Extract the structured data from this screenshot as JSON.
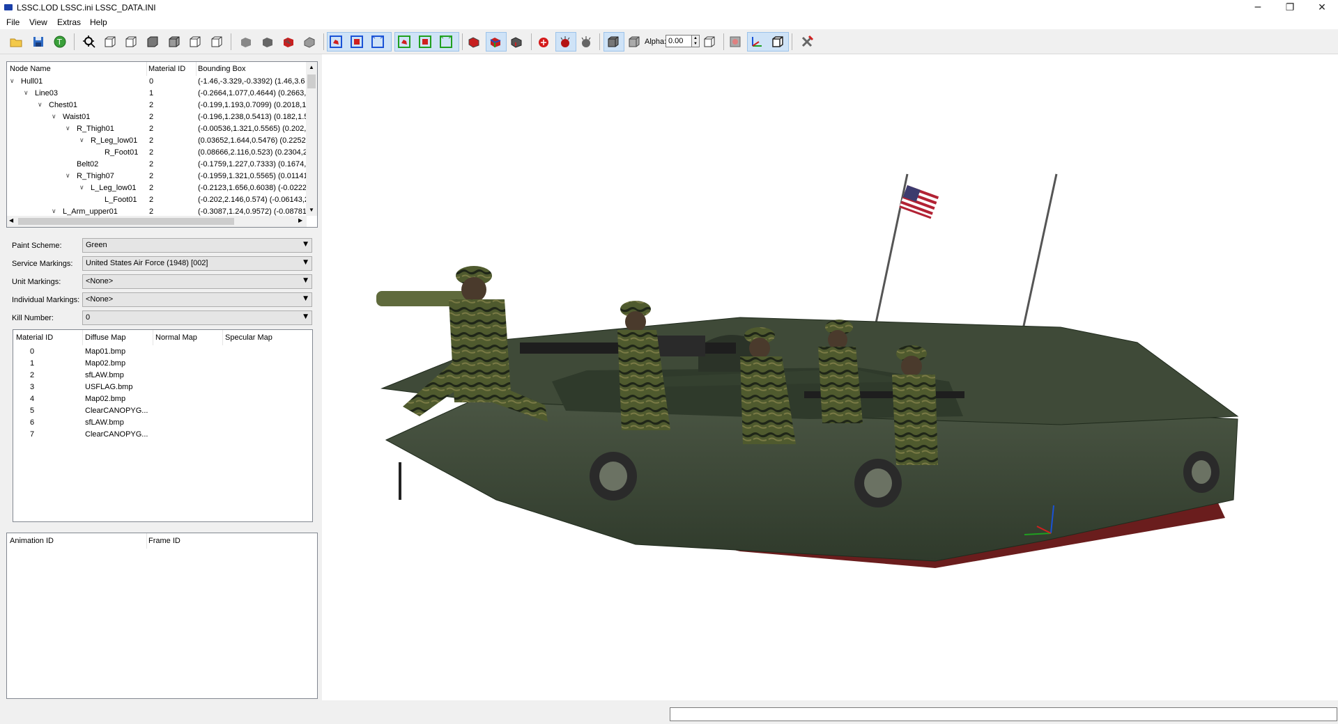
{
  "window": {
    "title": "LSSC.LOD  LSSC.ini  LSSC_DATA.INI",
    "min_glyph": "─",
    "max_glyph": "❐",
    "close_glyph": "✕"
  },
  "menu": [
    "File",
    "View",
    "Extras",
    "Help"
  ],
  "toolbar": {
    "alpha_label": "Alpha:",
    "alpha_value": "0.00"
  },
  "node_tree": {
    "headers": [
      "Node Name",
      "Material ID",
      "Bounding Box"
    ],
    "rows": [
      {
        "name": "Hull01",
        "material": "0",
        "bbox": "(-1.46,-3.329,-0.3392) (1.46,3.6"
      },
      {
        "name": "Line03",
        "material": "1",
        "bbox": "(-0.2664,1.077,0.4644) (0.2663,"
      },
      {
        "name": "Chest01",
        "material": "2",
        "bbox": "(-0.199,1.193,0.7099) (0.2018,1."
      },
      {
        "name": "Waist01",
        "material": "2",
        "bbox": "(-0.196,1.238,0.5413) (0.182,1.5"
      },
      {
        "name": "R_Thigh01",
        "material": "2",
        "bbox": "(-0.00536,1.321,0.5565) (0.202,"
      },
      {
        "name": "R_Leg_low01",
        "material": "2",
        "bbox": "(0.03652,1.644,0.5476) (0.2252,"
      },
      {
        "name": "R_Foot01",
        "material": "2",
        "bbox": "(0.08666,2.116,0.523) (0.2304,2"
      },
      {
        "name": "Belt02",
        "material": "2",
        "bbox": "(-0.1759,1.227,0.7333) (0.1674,"
      },
      {
        "name": "R_Thigh07",
        "material": "2",
        "bbox": "(-0.1959,1.321,0.5565) (0.01141"
      },
      {
        "name": "L_Leg_low01",
        "material": "2",
        "bbox": "(-0.2123,1.656,0.6038) (-0.0222"
      },
      {
        "name": "L_Foot01",
        "material": "2",
        "bbox": "(-0.202,2.146,0.574) (-0.06143,2"
      },
      {
        "name": "L_Arm_upper01",
        "material": "2",
        "bbox": "(-0.3087,1.24,0.9572) (-0.08781"
      }
    ]
  },
  "form": {
    "paint_scheme_label": "Paint Scheme:",
    "paint_scheme_value": "Green",
    "service_markings_label": "Service Markings:",
    "service_markings_value": "United States Air Force (1948) [002]",
    "unit_markings_label": "Unit Markings:",
    "unit_markings_value": "<None>",
    "individual_markings_label": "Individual Markings:",
    "individual_markings_value": "<None>",
    "kill_number_label": "Kill Number:",
    "kill_number_value": "0"
  },
  "materials": {
    "headers": [
      "Material ID",
      "Diffuse Map",
      "Normal Map",
      "Specular Map"
    ],
    "rows": [
      {
        "id": "0",
        "diffuse": "Map01.bmp"
      },
      {
        "id": "1",
        "diffuse": "Map02.bmp"
      },
      {
        "id": "2",
        "diffuse": "sfLAW.bmp"
      },
      {
        "id": "3",
        "diffuse": "USFLAG.bmp"
      },
      {
        "id": "4",
        "diffuse": "Map02.bmp"
      },
      {
        "id": "5",
        "diffuse": "ClearCANOPYG..."
      },
      {
        "id": "6",
        "diffuse": "sfLAW.bmp"
      },
      {
        "id": "7",
        "diffuse": "ClearCANOPYG..."
      }
    ]
  },
  "animations": {
    "headers": [
      "Animation ID",
      "Frame ID"
    ]
  },
  "colors": {
    "hull": "#3f4a38",
    "camo_a": "#4f5a2e",
    "camo_b": "#1f2618",
    "select_blue": "#1a52d6"
  }
}
